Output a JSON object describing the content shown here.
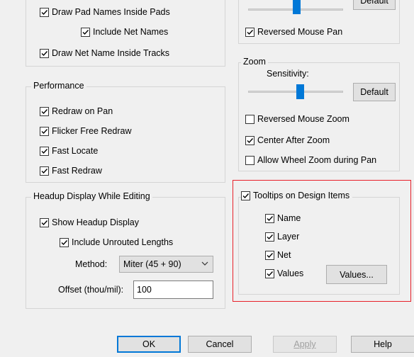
{
  "left_top": {
    "draw_pad_names": {
      "label": "Draw Pad Names Inside Pads",
      "checked": true
    },
    "include_net_names": {
      "label": "Include Net Names",
      "checked": true
    },
    "draw_net_name_tracks": {
      "label": "Draw Net Name Inside Tracks",
      "checked": true
    }
  },
  "performance": {
    "title": "Performance",
    "items": [
      {
        "label": "Redraw on Pan",
        "checked": true
      },
      {
        "label": "Flicker Free Redraw",
        "checked": true
      },
      {
        "label": "Fast Locate",
        "checked": true
      },
      {
        "label": "Fast Redraw",
        "checked": true
      }
    ]
  },
  "headup": {
    "title": "Headup Display While Editing",
    "show_headup": {
      "label": "Show Headup Display",
      "checked": true
    },
    "include_unrouted": {
      "label": "Include Unrouted Lengths",
      "checked": true
    },
    "method_label": "Method:",
    "method_value": "Miter (45 + 90)",
    "offset_label": "Offset (thou/mil):",
    "offset_value": "100"
  },
  "pan": {
    "default_label": "Default",
    "reversed_mouse_pan": {
      "label": "Reversed Mouse Pan",
      "checked": true
    }
  },
  "zoom": {
    "title": "Zoom",
    "sensitivity_label": "Sensitivity:",
    "sensitivity_level": 0.55,
    "default_label": "Default",
    "items": [
      {
        "label": "Reversed Mouse Zoom",
        "checked": false
      },
      {
        "label": "Center After Zoom",
        "checked": true
      },
      {
        "label": "Allow Wheel Zoom during Pan",
        "checked": false
      }
    ]
  },
  "tooltips": {
    "title": {
      "label": "Tooltips on Design Items",
      "checked": true
    },
    "items": [
      {
        "label": "Name",
        "checked": true
      },
      {
        "label": "Layer",
        "checked": true
      },
      {
        "label": "Net",
        "checked": true
      },
      {
        "label": "Values",
        "checked": true
      }
    ],
    "values_button": "Values..."
  },
  "footer": {
    "ok": "OK",
    "cancel": "Cancel",
    "apply": "Apply",
    "help": "Help"
  },
  "colors": {
    "accent": "#0078d7",
    "highlight": "#e8202a"
  }
}
